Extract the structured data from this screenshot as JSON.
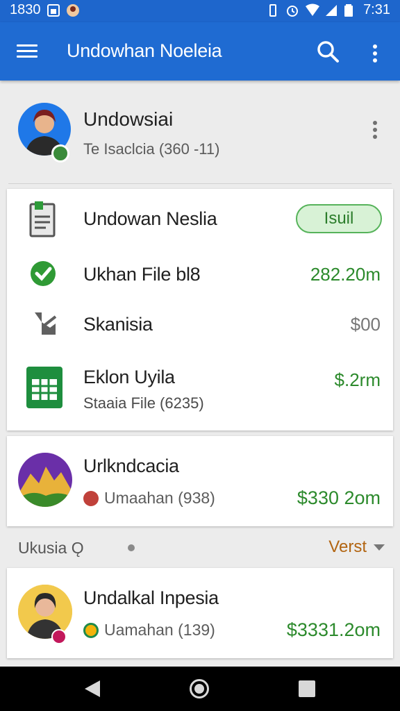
{
  "status_bar": {
    "time_left": "1830",
    "time_right": "7:31"
  },
  "app_bar": {
    "title": "Undowhan Noeleia"
  },
  "profile": {
    "name": "Undowsiai",
    "subtitle": "Te Isaclcia  (360 -11)"
  },
  "files_card": {
    "items": [
      {
        "label": "Undowan Neslia",
        "badge": "Isuil",
        "icon": "document-icon"
      },
      {
        "label": "Ukhan File bl8",
        "value": "282.20m",
        "icon": "check-circle-icon"
      },
      {
        "label": "Skanisia",
        "value": "$00",
        "icon": "edit-file-icon"
      },
      {
        "label": "Eklon Uyila",
        "sublabel": "Staaia File (6235)",
        "value": "$.2rm",
        "icon": "spreadsheet-icon"
      }
    ]
  },
  "entry1": {
    "title": "Urlkndcacia",
    "sub": "Umaahan  (938)",
    "amount": "$330 2om"
  },
  "section": {
    "label": "Ukusia Ǫ",
    "sort_label": "Verst"
  },
  "entry2": {
    "title": "Undalkal Inpesia",
    "sub": "Uamahan  (139)",
    "amount": "$3331.2om"
  },
  "colors": {
    "app_bar": "#1f6bd2",
    "accent_green": "#2c8a2c",
    "sort_orange": "#b26512"
  }
}
